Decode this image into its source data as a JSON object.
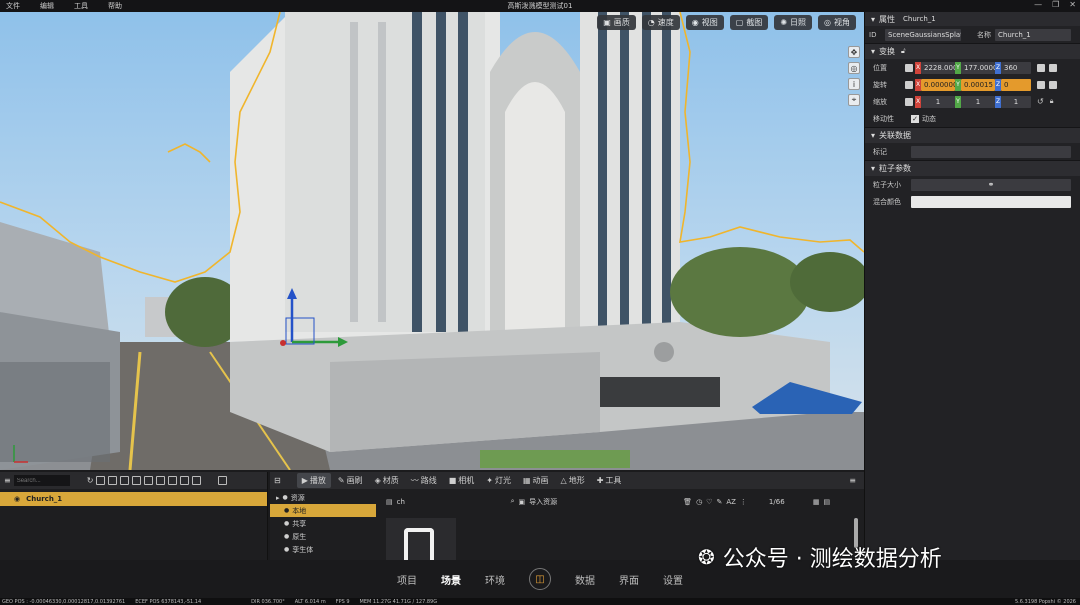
{
  "menu": [
    "文件",
    "编辑",
    "工具",
    "帮助"
  ],
  "window_title": "高斯泼溅模型测试01",
  "viewport_toolbar": [
    {
      "icon": "image-icon",
      "label": "画质"
    },
    {
      "icon": "speed-icon",
      "label": "速度"
    },
    {
      "icon": "eye-icon",
      "label": "视图"
    },
    {
      "icon": "screenshot-icon",
      "label": "截图"
    },
    {
      "icon": "sun-icon",
      "label": "日照"
    },
    {
      "icon": "camera-view-icon",
      "label": "视角"
    }
  ],
  "properties": {
    "header": "属性",
    "object_name": "Church_1",
    "id_label": "ID",
    "id_value": "SceneGaussiansSplat_",
    "name_label": "名称",
    "name_value": "Church_1",
    "transform_title": "变换",
    "position_label": "位置",
    "position": {
      "x": "2228.000",
      "y": "177.0000",
      "z": "360"
    },
    "rotation_label": "旋转",
    "rotation": {
      "x": "0.000000",
      "y": "0.00015",
      "z": "0"
    },
    "scale_label": "缩放",
    "scale": {
      "x": "1",
      "y": "1",
      "z": "1"
    },
    "mobility_label": "移动性",
    "mobility_value": "动态",
    "linked_title": "关联数据",
    "tag_label": "标记",
    "particle_title": "粒子参数",
    "particle_size_label": "粒子大小",
    "blend_color_label": "混合颜色"
  },
  "hierarchy": {
    "search_placeholder": "Search...",
    "item": "Church_1"
  },
  "asset_tabs": [
    {
      "icon": "play-icon",
      "label": "播放"
    },
    {
      "icon": "brush-icon",
      "label": "画刷"
    },
    {
      "icon": "material-icon",
      "label": "材质"
    },
    {
      "icon": "route-icon",
      "label": "路线"
    },
    {
      "icon": "camera-icon",
      "label": "相机"
    },
    {
      "icon": "light-icon",
      "label": "灯光"
    },
    {
      "icon": "animation-icon",
      "label": "动画"
    },
    {
      "icon": "terrain-icon",
      "label": "地形"
    },
    {
      "icon": "tool-icon",
      "label": "工具"
    }
  ],
  "asset_tree": [
    "资源",
    "本地",
    "共享",
    "原生",
    "孪生体"
  ],
  "asset_search": "ch",
  "import_label": "导入资源",
  "page_count": "1/66",
  "bottom_nav": [
    "项目",
    "场景",
    "环境",
    "数据",
    "界面",
    "设置"
  ],
  "status": {
    "geo": "GEO POS : -0.00046330,0.00012817,0.01392761",
    "ecef": "ECEF POS 6378143,-51.14",
    "dir": "DIR 036.700°",
    "alt": "ALT 6.014 m",
    "fps": "FPS 9",
    "mem": "MEM 11.27G 41.71G / 127.89G",
    "ver": "5.6.3198 Popshi © 2026"
  },
  "watermark": "公众号 · 测绘数据分析"
}
